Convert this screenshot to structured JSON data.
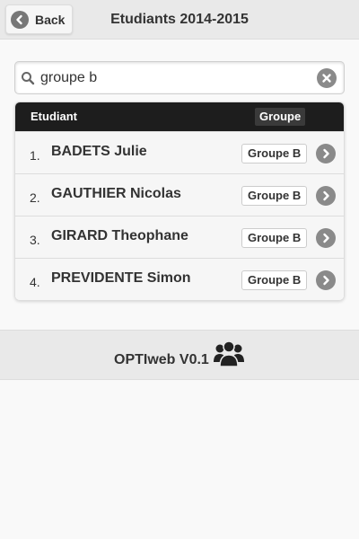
{
  "header": {
    "back_label": "Back",
    "title": "Etudiants 2014-2015"
  },
  "search": {
    "value": "groupe b",
    "icon": "search-icon",
    "clear_icon": "close-icon"
  },
  "list": {
    "columns": {
      "student": "Etudiant",
      "group": "Groupe"
    },
    "rows": [
      {
        "num": "1.",
        "name": "BADETS Julie",
        "group": "Groupe B"
      },
      {
        "num": "2.",
        "name": "GAUTHIER Nicolas",
        "group": "Groupe B"
      },
      {
        "num": "3.",
        "name": "GIRARD Theophane",
        "group": "Groupe B"
      },
      {
        "num": "4.",
        "name": "PREVIDENTE Simon",
        "group": "Groupe B"
      }
    ],
    "row_icon": "chevron-right-icon"
  },
  "footer": {
    "text": "OPTIweb V0.1",
    "icon": "group-users-icon"
  },
  "colors": {
    "header_bg": "#e9e9e9",
    "list_head_bg": "#1d1d1d",
    "row_bg": "#f6f6f6",
    "icon_grey": "#8a8a8a"
  }
}
